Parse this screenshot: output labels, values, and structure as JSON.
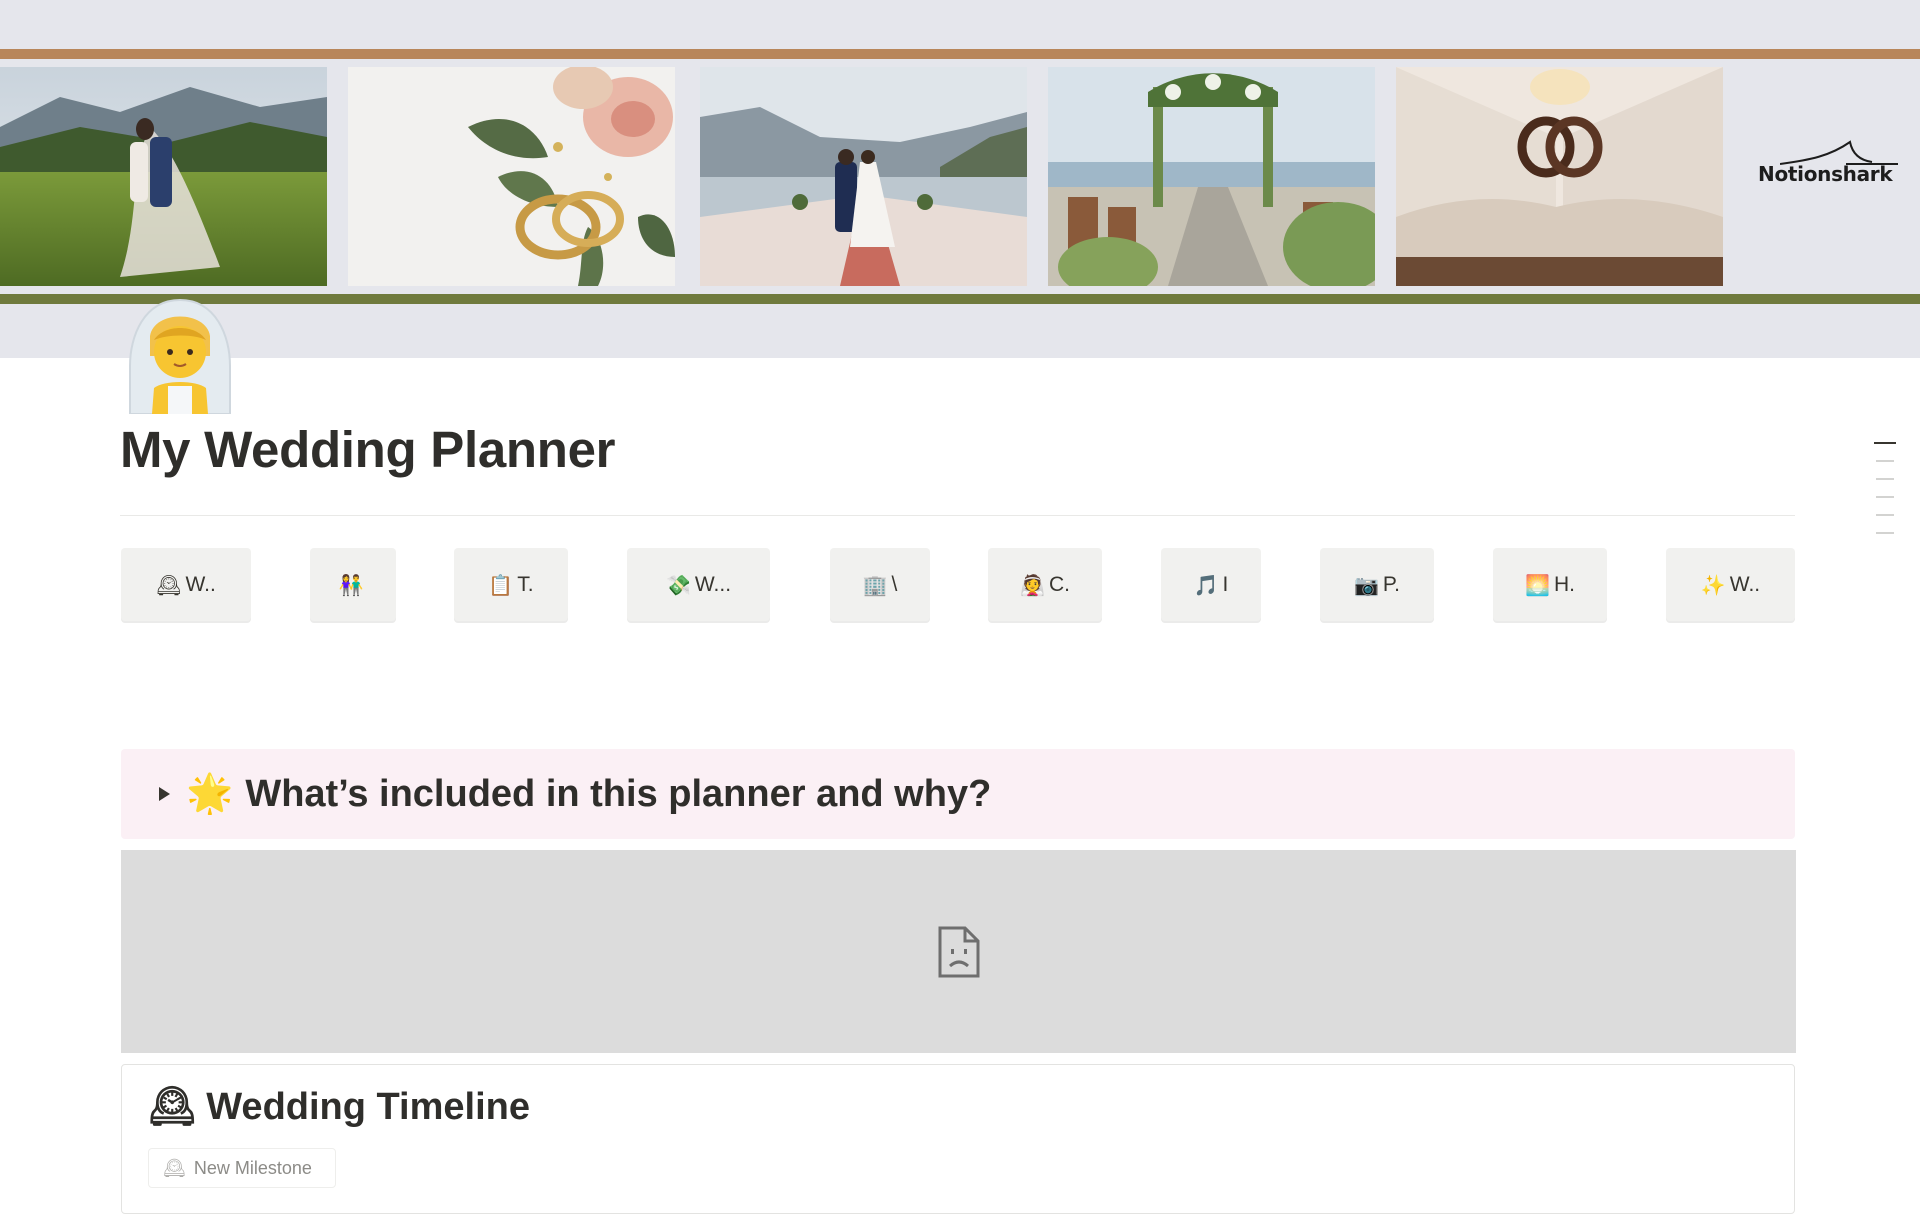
{
  "page": {
    "title": "My Wedding Planner",
    "icon": "bride-with-veil-icon"
  },
  "cover": {
    "brand_name": "Notionshark",
    "stripe_top_color": "#b8865a",
    "stripe_bottom_color": "#6f7a3d",
    "photos": [
      "couple-in-meadow-photo",
      "wedding-rings-with-roses-photo",
      "couple-walking-aisle-photo",
      "floral-arch-ceremony-photo",
      "rings-on-open-book-photo"
    ]
  },
  "nav": {
    "buttons": [
      {
        "icon": "🕰",
        "label": "W..",
        "name": "nav-wedding-timeline-button"
      },
      {
        "icon": "👫",
        "label": "",
        "name": "nav-guests-button"
      },
      {
        "icon": "📋",
        "label": "T.",
        "name": "nav-tasks-button"
      },
      {
        "icon": "💸",
        "label": "W...",
        "name": "nav-wedding-budget-button"
      },
      {
        "icon": "🏢",
        "label": "\\",
        "name": "nav-venues-button"
      },
      {
        "icon": "👰",
        "label": "C.",
        "name": "nav-ceremony-button"
      },
      {
        "icon": "🎵",
        "label": "I",
        "name": "nav-music-button"
      },
      {
        "icon": "📷",
        "label": "P.",
        "name": "nav-photography-button"
      },
      {
        "icon": "🌅",
        "label": "H.",
        "name": "nav-honeymoon-button"
      },
      {
        "icon": "✨",
        "label": "W..",
        "name": "nav-wishlist-button"
      }
    ]
  },
  "callout": {
    "icon": "🌟",
    "text": "What’s included in this planner and why?"
  },
  "embed": {
    "state": "broken",
    "icon": "broken-file-icon"
  },
  "timeline": {
    "icon": "🕰",
    "title": "Wedding Timeline",
    "new_button_icon": "🕰",
    "new_button_label": "New Milestone"
  }
}
